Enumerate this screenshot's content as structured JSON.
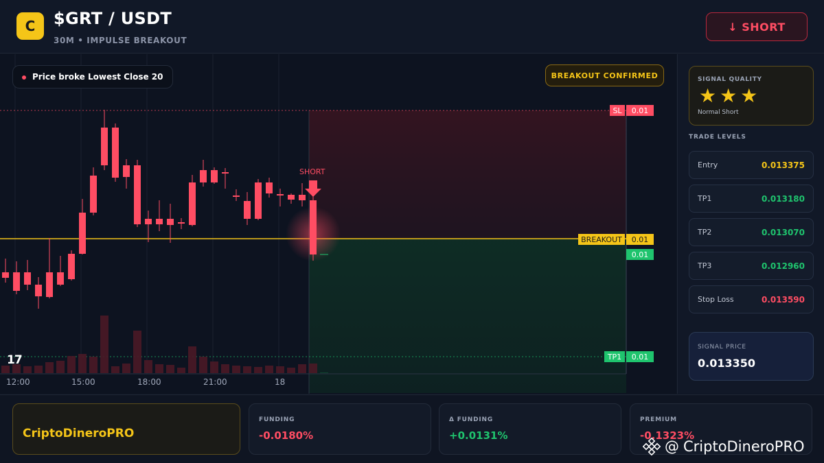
{
  "header": {
    "logo_letter": "C",
    "pair": "$GRT / USDT",
    "subtitle": "30M • IMPULSE BREAKOUT",
    "action_label": "↓ SHORT"
  },
  "chart": {
    "pill_text": "Price broke Lowest Close 20",
    "confirmed_text": "BREAKOUT CONFIRMED",
    "sl_name": "SL",
    "sl_value": "0.01",
    "breakout_name": "BREAKOUT",
    "breakout_value": "0.01",
    "current_value": "0.01",
    "tp1_name": "TP1",
    "tp1_value": "0.01",
    "short_marker": "SHORT",
    "tv_logo": "17",
    "time_labels": [
      "12:00",
      "15:00",
      "18:00",
      "21:00",
      "18"
    ],
    "colors": {
      "bull": "#1fc46e",
      "bear": "#ff4d63",
      "breakout": "#f5c518"
    }
  },
  "side": {
    "quality_title": "SIGNAL QUALITY",
    "stars": 3,
    "quality_sub": "Normal Short",
    "levels_title": "TRADE LEVELS",
    "levels": [
      {
        "name": "Entry",
        "value": "0.013375",
        "color": "#f5c518"
      },
      {
        "name": "TP1",
        "value": "0.013180",
        "color": "#1fc46e"
      },
      {
        "name": "TP2",
        "value": "0.013070",
        "color": "#1fc46e"
      },
      {
        "name": "TP3",
        "value": "0.012960",
        "color": "#1fc46e"
      },
      {
        "name": "Stop Loss",
        "value": "0.013590",
        "color": "#ff4d63"
      }
    ],
    "signal_label": "SIGNAL PRICE",
    "signal_value": "0.013350"
  },
  "bottom": {
    "brand": "CriptoDineroPRO",
    "stats": [
      {
        "label": "FUNDING",
        "value": "-0.0180%",
        "color": "#ff4d63"
      },
      {
        "label": "Δ FUNDING",
        "value": "+0.0131%",
        "color": "#1fc46e"
      },
      {
        "label": "PREMIUM",
        "value": "-0.1323%",
        "color": "#ff4d63"
      }
    ],
    "watermark": "CriptoDineroPRO",
    "watermark_at": "@"
  }
}
